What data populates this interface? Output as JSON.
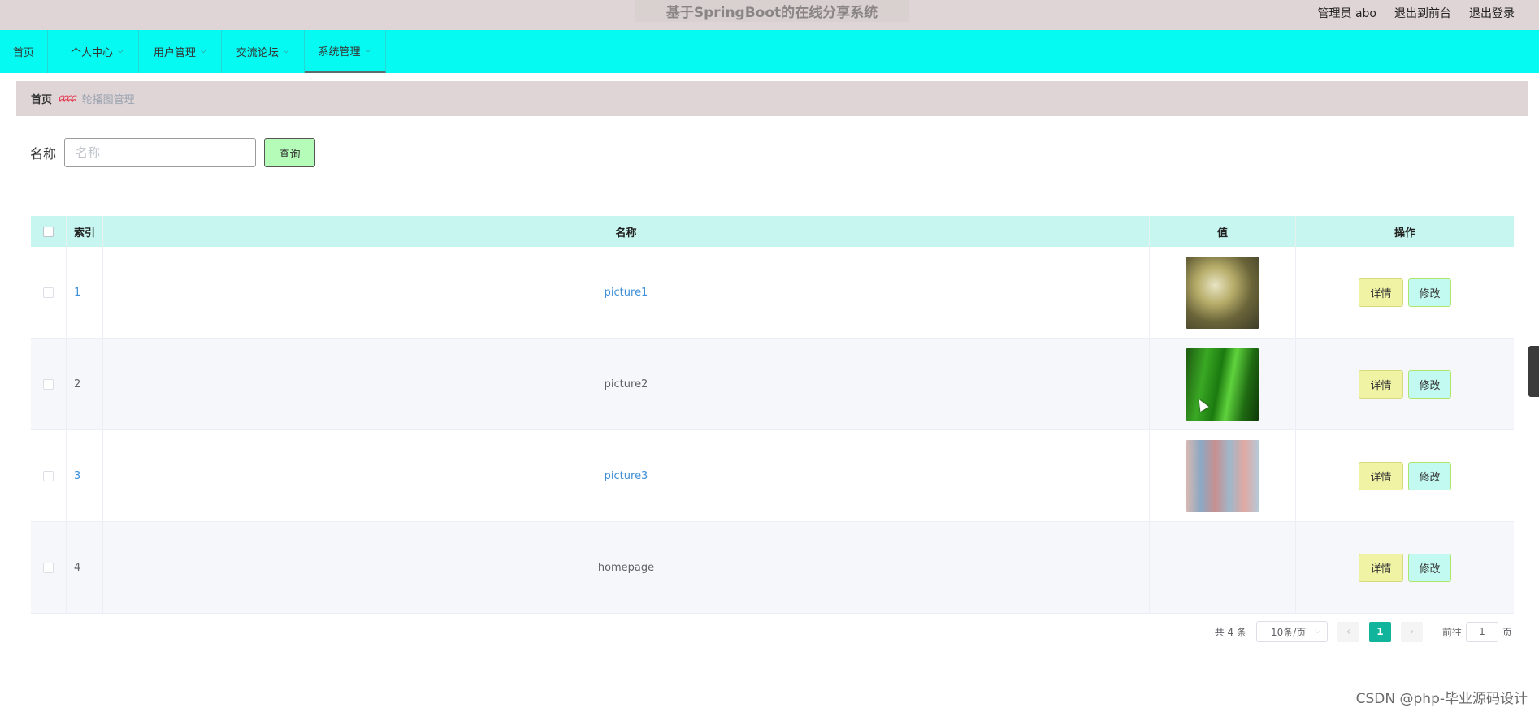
{
  "app": {
    "title": "基于SpringBoot的在线分享系统",
    "user_label": "管理员 abo",
    "to_front": "退出到前台",
    "logout": "退出登录"
  },
  "nav": {
    "items": [
      {
        "label": "首页",
        "has_dropdown": false
      },
      {
        "label": "个人中心",
        "has_dropdown": true
      },
      {
        "label": "用户管理",
        "has_dropdown": true
      },
      {
        "label": "交流论坛",
        "has_dropdown": true
      },
      {
        "label": "系统管理",
        "has_dropdown": true,
        "active": true
      }
    ]
  },
  "breadcrumb": {
    "home": "首页",
    "current": "轮播图管理"
  },
  "search": {
    "label": "名称",
    "placeholder": "名称",
    "value": "",
    "button": "查询"
  },
  "table": {
    "columns": [
      "索引",
      "名称",
      "值",
      "操作"
    ],
    "rows": [
      {
        "index": "1",
        "name": "picture1",
        "image": "picture1",
        "linked": true
      },
      {
        "index": "2",
        "name": "picture2",
        "image": "picture2",
        "linked": false
      },
      {
        "index": "3",
        "name": "picture3",
        "image": "picture3",
        "linked": true
      },
      {
        "index": "4",
        "name": "homepage",
        "image": "",
        "linked": false
      }
    ],
    "detail_label": "详情",
    "edit_label": "修改"
  },
  "pagination": {
    "total": "共 4 条",
    "page_size": "10条/页",
    "current_page": "1",
    "goto_prefix": "前往",
    "goto_value": "1",
    "goto_suffix": "页"
  },
  "watermark": "CSDN @php-毕业源码设计",
  "colors": {
    "topbar": "#e0d5d6",
    "navbar": "#05fbf2",
    "table_header": "#c6f6ef",
    "search_button": "#b4fcb7",
    "detail_button": "#f1f3a4",
    "edit_button": "#c2f9f0",
    "page_active": "#11b59b"
  }
}
